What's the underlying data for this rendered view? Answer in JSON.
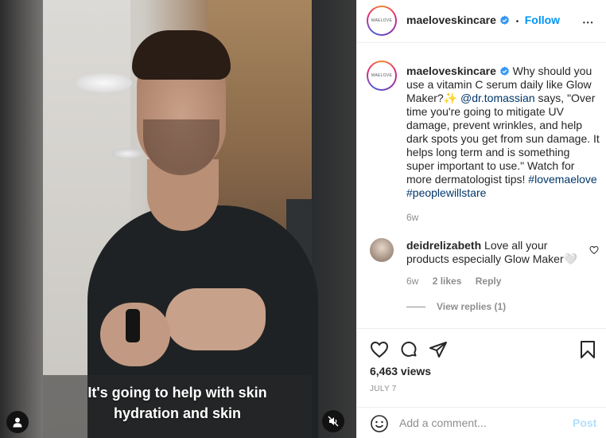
{
  "video": {
    "caption_line1": "It's going to help with skin",
    "caption_line2": "hydration and skin"
  },
  "header": {
    "avatar_text": "MAELOVE",
    "username": "maeloveskincare",
    "separator": "•",
    "follow_label": "Follow",
    "more_label": "•••"
  },
  "post": {
    "username": "maeloveskincare",
    "text_part1": "Why should you use a vitamin C serum daily like Glow Maker?",
    "sparkle": "✨",
    "mention": "@dr.tomassian",
    "text_part2": " says, \"Over time you're going to mitigate UV damage, prevent wrinkles, and help dark spots you get from sun damage. It helps long term and is something super important to use.\" Watch for more dermatologist tips! ",
    "hashtag1": "#lovemaelove",
    "hashtag2": "#peoplewillstare",
    "age": "6w"
  },
  "comment": {
    "username": "deidrelizabeth",
    "text": "Love all your products especially Glow Maker",
    "heart_emoji": "🤍",
    "age": "6w",
    "likes": "2 likes",
    "reply_label": "Reply",
    "view_replies": "View replies (1)"
  },
  "stats": {
    "views": "6,463 views",
    "date": "JULY 7"
  },
  "composer": {
    "placeholder": "Add a comment...",
    "post_label": "Post"
  },
  "colors": {
    "link": "#00376b",
    "follow": "#0095f6",
    "muted": "#8e8e8e",
    "post_disabled": "#b2dffc",
    "verified": "#3897f0"
  }
}
